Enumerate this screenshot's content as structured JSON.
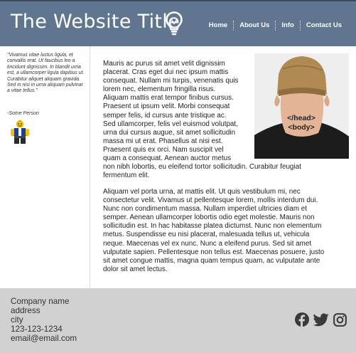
{
  "header": {
    "site_title": "The Website Title",
    "nav": [
      "Home",
      "About Us",
      "Info",
      "Contact Us"
    ]
  },
  "sidebar": {
    "quote": "\"Vivamus vitae luctus ligula, et convallis erat. Ut faucibus leo a tincidunt dignissim. In blandit urna est, a ullamcorper ligula dapibus ut. Curabitur aliquet aliquam gravida. Sed in nisi in urna aliquam pulvinar a vitae tellus.\"",
    "author": "-Some Person"
  },
  "main": {
    "paragraph1_lines": [
      "Mauris ac purus sit amet velit dignissim",
      "placerat. Cras eget dui nec ipsum mattis",
      "consequat. Nullam mi turpis, venenatis quis",
      "lorem nec, elementum fringilla risus.",
      "Aliquam mattis erat tempor finibus cursus.",
      "Praesent ut ipsum velit. Morbi consequat",
      "semper felis, id cursus ante tristique ac.",
      "Sed ullamcorper, felis vel euismod volutpat,",
      "urna dui cursus augue, sit amet sollicitudin",
      "massa mi ut erat. Phasellus at nisi est.",
      "Praesent quis ex orci. Nam suscipit vel",
      "quam a consequat. Aenean auctor metus",
      "non nibh lobortis, eu eleifend tortor sollicitudin. Curabitur feugiat",
      "fermentum elit."
    ],
    "paragraph2_lines": [
      "Aliquam vel porta urna, at mattis elit. Ut quis vestibulum mi, nec",
      "consectetur velit. Vivamus ut pellentesque lorem, mollis interdum dui.",
      "Nunc non condimentum massa. Nullam imperdiet ultricies diam et",
      "semper. Aenean ullamcorper lobortis odio eget molestie. Mauris non",
      "sollicitudin est. In hac habitasse platea dictumst. Nunc non elementum",
      "metus. Suspendisse eu nisi placerat, malesuada tellus ut, vehicula",
      "neque. Maecenas vel ex nunc. Nunc a eleifend purus. Sed sit amet",
      "vulputate sapien. Pellentesque non tellus est. Maecenas posuere, justo",
      "sit amet congue mattis, magna quam tempus quam, ac vulputate ante",
      "dolor sit amet lectus."
    ],
    "tattoo_line1": "</head>",
    "tattoo_line2": "<body>"
  },
  "footer": {
    "company": "Company name",
    "address": "address",
    "city": "city",
    "phone": "123-123-1234",
    "email": "email@email.com"
  },
  "colors": {
    "header_bg": "#5f7590",
    "footer_bg": "#d1d1d1",
    "social_icon": "#3a3a3a"
  },
  "icons": [
    "lightbulb-icon",
    "lego-figure-icon",
    "facebook-icon",
    "twitter-icon",
    "instagram-icon"
  ]
}
